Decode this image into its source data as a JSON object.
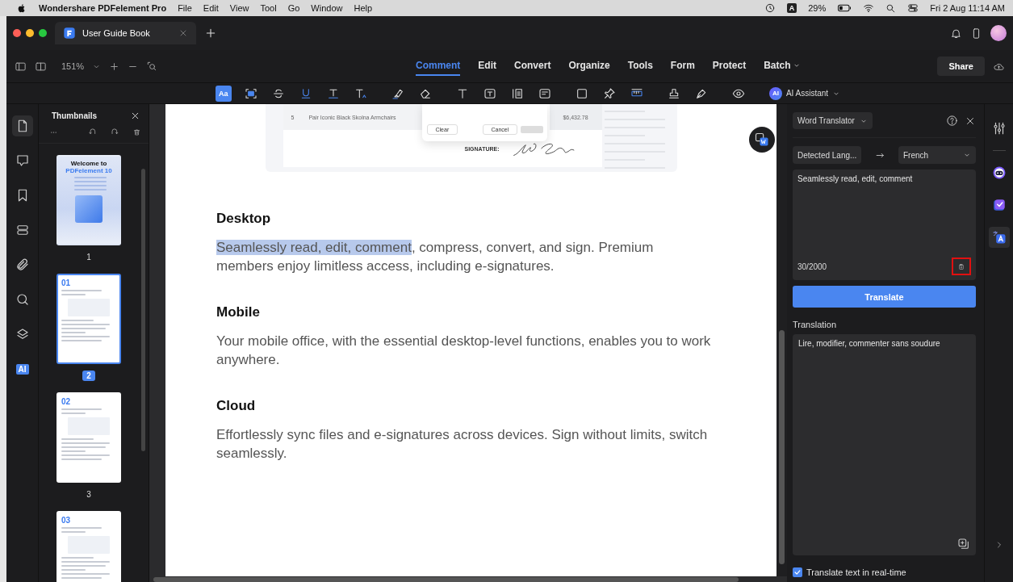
{
  "menu_bar": {
    "app_name": "Wondershare PDFelement Pro",
    "menus": [
      "File",
      "Edit",
      "View",
      "Tool",
      "Go",
      "Window",
      "Help"
    ],
    "input_source": "A",
    "battery": "29%",
    "datetime": "Fri 2 Aug  11:14 AM"
  },
  "tab_bar": {
    "tabs": [
      {
        "title": "User Guide Book",
        "selected": true
      }
    ]
  },
  "toolbar": {
    "zoom": "151%",
    "nav_tabs": [
      {
        "label": "Comment",
        "selected": true,
        "dropdown": false
      },
      {
        "label": "Edit",
        "selected": false,
        "dropdown": false
      },
      {
        "label": "Convert",
        "selected": false,
        "dropdown": false
      },
      {
        "label": "Organize",
        "selected": false,
        "dropdown": false
      },
      {
        "label": "Tools",
        "selected": false,
        "dropdown": false
      },
      {
        "label": "Form",
        "selected": false,
        "dropdown": false
      },
      {
        "label": "Protect",
        "selected": false,
        "dropdown": false
      },
      {
        "label": "Batch",
        "selected": false,
        "dropdown": true
      }
    ],
    "share": "Share"
  },
  "annotation_tools": [
    {
      "kind": "text-style",
      "label": "Aa",
      "selected": true
    },
    {
      "kind": "area-text",
      "selected": false
    },
    {
      "kind": "strikethrough",
      "selected": false
    },
    {
      "kind": "underline",
      "selected": false
    },
    {
      "kind": "baseline",
      "selected": false
    },
    {
      "kind": "insert-text",
      "selected": false
    },
    {
      "kind": "highlighter",
      "selected": false
    },
    {
      "kind": "eraser",
      "selected": false
    },
    {
      "kind": "text",
      "selected": false
    },
    {
      "kind": "text-box",
      "selected": false
    },
    {
      "kind": "callout",
      "selected": false
    },
    {
      "kind": "note",
      "selected": false
    },
    {
      "kind": "rectangle",
      "selected": false
    },
    {
      "kind": "pin",
      "selected": false
    },
    {
      "kind": "ruler",
      "selected": false
    },
    {
      "kind": "stamp",
      "selected": false
    },
    {
      "kind": "pen",
      "selected": false
    },
    {
      "kind": "eye",
      "selected": false
    }
  ],
  "ai_assistant": {
    "badge": "AI",
    "label": "AI Assistant"
  },
  "left_rail": [
    {
      "kind": "page",
      "selected": true
    },
    {
      "kind": "comment",
      "selected": false
    },
    {
      "kind": "bookmark",
      "selected": false
    },
    {
      "kind": "fields",
      "selected": false
    },
    {
      "kind": "attachment",
      "selected": false
    },
    {
      "kind": "search",
      "selected": false
    },
    {
      "kind": "layers",
      "selected": false
    },
    {
      "kind": "ai",
      "label": "AI",
      "selected": false
    }
  ],
  "thumbnails": {
    "title": "Thumbnails",
    "pages": [
      {
        "kind": "cover",
        "heading": "Welcome to",
        "subheading": "PDFelement 10",
        "number": "1",
        "selected": false
      },
      {
        "kind": "section",
        "heading": "01",
        "number": "2",
        "selected": true
      },
      {
        "kind": "section",
        "heading": "02",
        "number": "3",
        "selected": false
      },
      {
        "kind": "section",
        "heading": "03",
        "selected": false
      }
    ]
  },
  "document": {
    "snippet": {
      "row_number": "5",
      "item": "Pair Iconic Black Skolna Armchairs",
      "amount": "$6,432.78",
      "buttons": [
        "Clear",
        "Cancel"
      ],
      "signature_label": "SIGNATURE:"
    },
    "sections": [
      {
        "heading": "Desktop",
        "highlight": "Seamlessly read, edit, comment",
        "text": ", compress, convert, and sign. Premium members enjoy limitless access, including e-signatures."
      },
      {
        "heading": "Mobile",
        "text": "Your mobile office, with the essential desktop-level functions, enables you to work anywhere."
      },
      {
        "heading": "Cloud",
        "text": "Effortlessly sync files and e-signatures across devices. Sign without limits, switch seamlessly."
      }
    ]
  },
  "translator": {
    "mode": "Word Translator",
    "source_lang": "Detected Lang...",
    "target_lang": "French",
    "input": "Seamlessly read, edit, comment",
    "count": "30/2000",
    "paste_marked": true,
    "translate_button": "Translate",
    "output_label": "Translation",
    "output": "Lire, modifier, commenter sans soudure",
    "realtime": {
      "label": "Translate text in real-time",
      "checked": true
    }
  },
  "right_rail": [
    {
      "kind": "settings",
      "selected": false
    },
    {
      "kind": "robot",
      "selected": false
    },
    {
      "kind": "task",
      "selected": false
    },
    {
      "kind": "translate",
      "selected": true
    }
  ]
}
